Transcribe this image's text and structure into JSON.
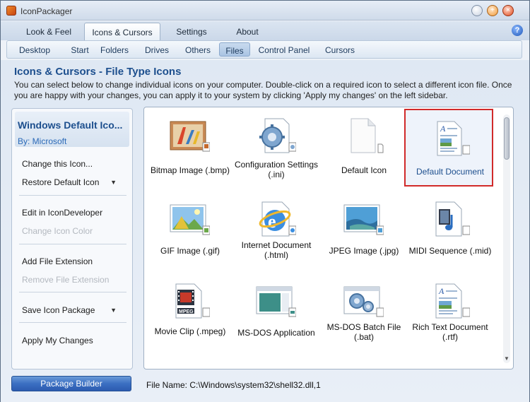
{
  "window": {
    "title": "IconPackager"
  },
  "main_tabs": [
    {
      "label": "Look & Feel",
      "active": false
    },
    {
      "label": "Icons & Cursors",
      "active": true
    },
    {
      "label": "Settings",
      "active": false
    },
    {
      "label": "About",
      "active": false
    }
  ],
  "sub_tabs": [
    {
      "label": "Desktop",
      "active": false
    },
    {
      "label": "Start",
      "active": false
    },
    {
      "label": "Folders",
      "active": false
    },
    {
      "label": "Drives",
      "active": false
    },
    {
      "label": "Others",
      "active": false
    },
    {
      "label": "Files",
      "active": true
    },
    {
      "label": "Control Panel",
      "active": false
    },
    {
      "label": "Cursors",
      "active": false
    }
  ],
  "page": {
    "heading": "Icons & Cursors - File Type Icons",
    "description": "You can select below to change individual icons on your computer. Double-click on a required icon to select a different icon file. Once you are happy with your changes, you can apply it to your system by clicking 'Apply my changes' on the left sidebar."
  },
  "sidebar": {
    "title": "Windows Default Ico...",
    "author": "By: Microsoft",
    "items": [
      {
        "label": "Change this Icon...",
        "enabled": true
      },
      {
        "label": "Restore Default Icon",
        "enabled": true
      },
      {
        "label": "Edit in IconDeveloper",
        "enabled": true
      },
      {
        "label": "Change Icon Color",
        "enabled": false
      },
      {
        "label": "Add File Extension",
        "enabled": true
      },
      {
        "label": "Remove File Extension",
        "enabled": false
      },
      {
        "label": "Save Icon Package",
        "enabled": true
      },
      {
        "label": "Apply My Changes",
        "enabled": true
      }
    ]
  },
  "package_builder_label": "Package Builder",
  "file_name": "File Name: C:\\Windows\\system32\\shell32.dll,1",
  "icons": [
    {
      "label": "Bitmap Image (.bmp)",
      "icon": "bitmap-icon"
    },
    {
      "label": "Configuration Settings (.ini)",
      "icon": "config-gear-icon"
    },
    {
      "label": "Default Icon",
      "icon": "blank-document-icon"
    },
    {
      "label": "Default Document",
      "icon": "text-document-icon",
      "selected": true
    },
    {
      "label": "GIF Image (.gif)",
      "icon": "gif-image-icon"
    },
    {
      "label": "Internet Document (.html)",
      "icon": "internet-explorer-icon"
    },
    {
      "label": "JPEG Image (.jpg)",
      "icon": "jpeg-image-icon"
    },
    {
      "label": "MIDI Sequence (.mid)",
      "icon": "midi-icon"
    },
    {
      "label": "Movie Clip (.mpeg)",
      "icon": "mpeg-film-icon"
    },
    {
      "label": "MS-DOS Application",
      "icon": "msdos-window-icon"
    },
    {
      "label": "MS-DOS Batch File (.bat)",
      "icon": "batch-gear-icon"
    },
    {
      "label": "Rich Text Document (.rtf)",
      "icon": "rtf-document-icon"
    }
  ]
}
